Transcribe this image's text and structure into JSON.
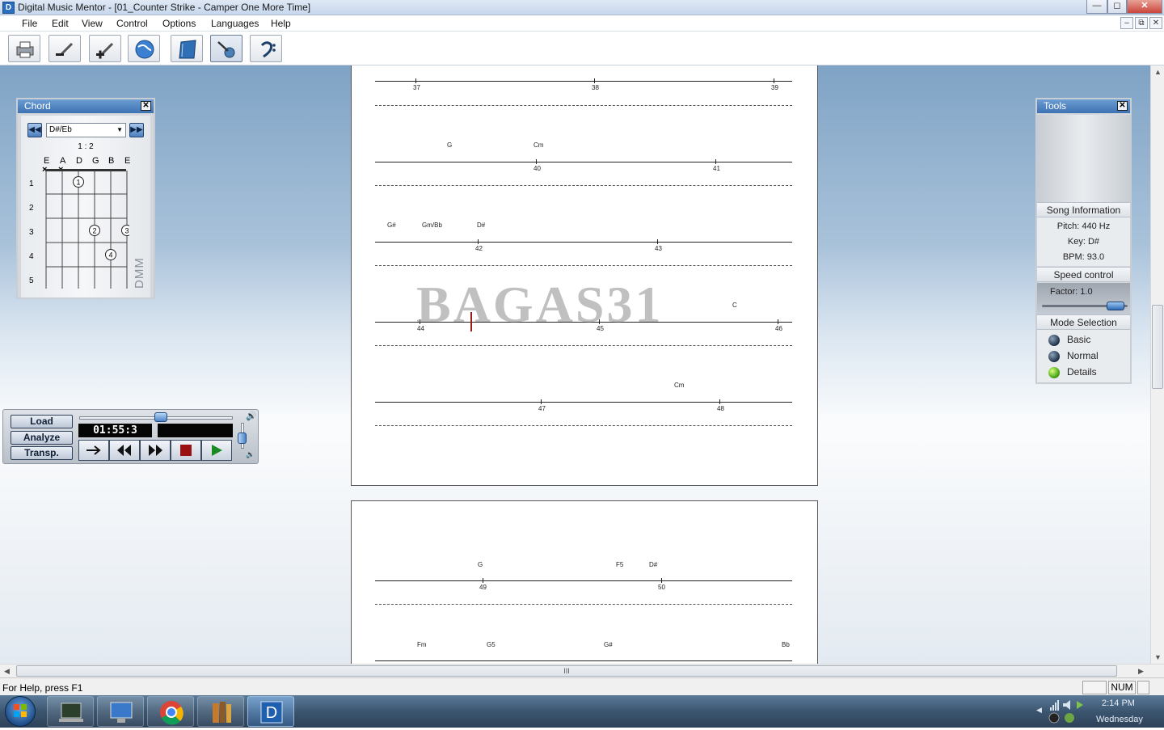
{
  "window": {
    "title": "Digital Music Mentor - [01_Counter Strike - Camper One More Time]",
    "app_icon_letter": "D",
    "controls": {
      "minimize": "—",
      "restore": "◻",
      "close": "✕"
    },
    "mdi_controls": {
      "minimize": "–",
      "restore": "⧉",
      "close": "✕"
    }
  },
  "menu": [
    "File",
    "Edit",
    "View",
    "Control",
    "Options",
    "Languages",
    "Help"
  ],
  "toolbar": {
    "buttons": [
      "printer-icon",
      "zoom-out-icon",
      "zoom-in-icon",
      "globe-icon",
      "notebook-icon",
      "guitar-icon",
      "bass-clef-icon"
    ],
    "active": "guitar-icon"
  },
  "chord_panel": {
    "title": "Chord",
    "selected": "D#/Eb",
    "ratio": "1 : 2",
    "strings": [
      "E",
      "A",
      "D",
      "G",
      "B",
      "E"
    ],
    "muted": [
      "×",
      "×"
    ],
    "frets": [
      "1",
      "2",
      "3",
      "4",
      "5"
    ],
    "fingers": [
      "1",
      "2",
      "3",
      "4"
    ],
    "brand": "DMM"
  },
  "tools_panel": {
    "title": "Tools",
    "song_info": {
      "header": "Song Information",
      "pitch": "Pitch:  440 Hz",
      "key": "Key:  D#",
      "bpm": "BPM:  93.0"
    },
    "speed": {
      "header": "Speed control",
      "factor": "Factor:  1.0"
    },
    "mode": {
      "header": "Mode Selection",
      "options": [
        "Basic",
        "Normal",
        "Details"
      ],
      "selected": "Details"
    }
  },
  "player": {
    "buttons": [
      "Load",
      "Analyze",
      "Transp."
    ],
    "time": "01:55:3",
    "volume_icons": [
      "speaker-loud-icon",
      "speaker-quiet-icon"
    ]
  },
  "sheet1": {
    "rows": [
      {
        "chords": [],
        "bars": [
          "37",
          "38",
          "39"
        ]
      },
      {
        "chords": [
          "G",
          "Cm"
        ],
        "bars": [
          "40",
          "41"
        ]
      },
      {
        "chords": [
          "G#",
          "Gm/Bb",
          "D#"
        ],
        "bars": [
          "42",
          "43"
        ]
      },
      {
        "chords": [
          "C"
        ],
        "bars": [
          "44",
          "45",
          "46"
        ]
      },
      {
        "chords": [
          "Cm"
        ],
        "bars": [
          "47",
          "48"
        ]
      }
    ]
  },
  "sheet2": {
    "rows": [
      {
        "chords": [
          "G",
          "F5",
          "D#"
        ],
        "bars": [
          "49",
          "50"
        ]
      },
      {
        "chords": [
          "Fm",
          "G5",
          "G#",
          "Bb"
        ],
        "bars": []
      }
    ]
  },
  "watermark": "BAGAS31",
  "status": {
    "help": "For Help, press F1",
    "num": "NUM"
  },
  "taskbar": {
    "items": [
      "terminal-icon",
      "computer-icon",
      "chrome-icon",
      "books-icon",
      "dmm-app-icon"
    ],
    "active": "dmm-app-icon",
    "time": "2:14 PM",
    "day": "Wednesday"
  },
  "scroll": {
    "grip": "III",
    "left": "◀",
    "right": "▶",
    "up": "▲",
    "down": "▼"
  }
}
